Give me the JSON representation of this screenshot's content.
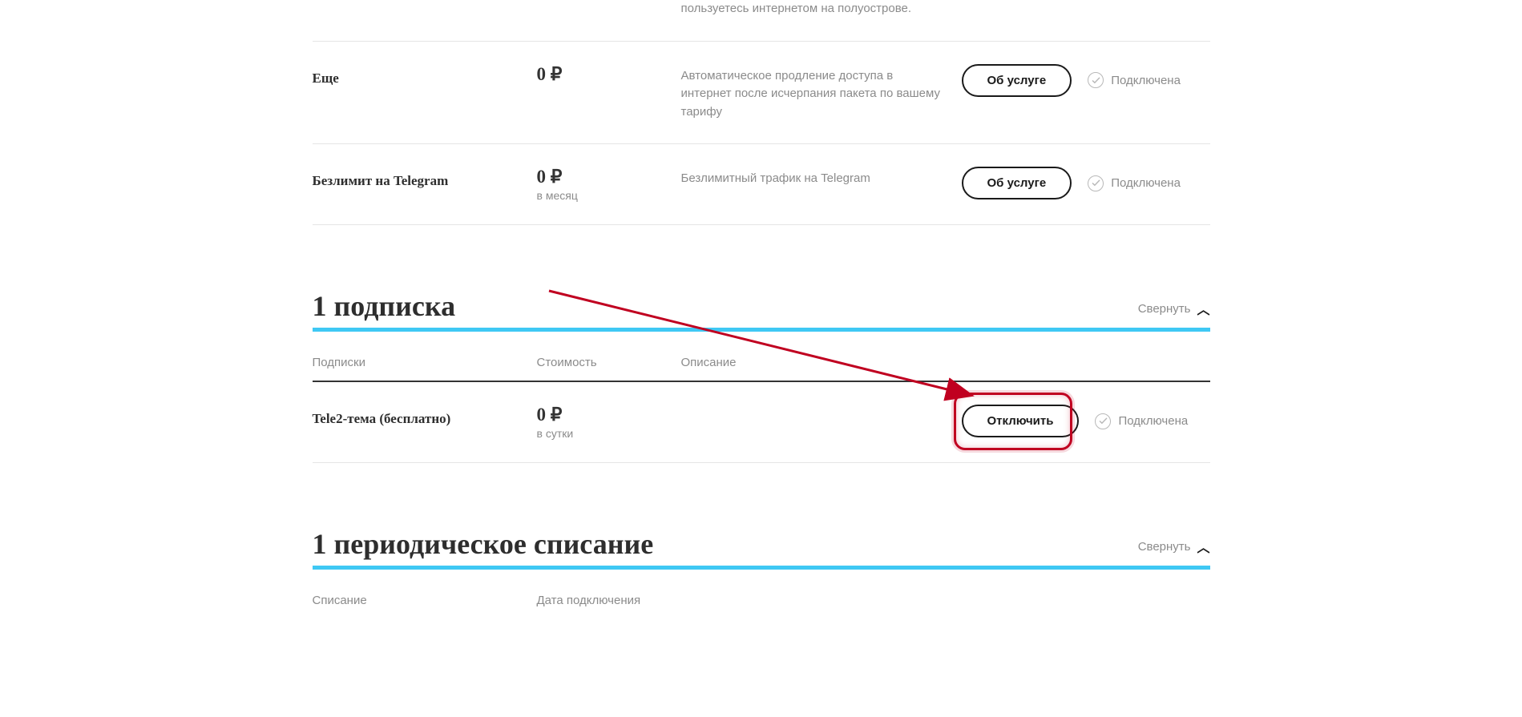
{
  "top_partial_desc": "пользуетесь интернетом на полуострове.",
  "services": [
    {
      "name": "Еще",
      "price": "0 ₽",
      "price_sub": "",
      "desc": "Автоматическое продление доступа в интернет после исчерпания пакета по вашему тарифу",
      "action": "Об услуге",
      "status": "Подключена"
    },
    {
      "name": "Безлимит на Telegram",
      "price": "0 ₽",
      "price_sub": "в месяц",
      "desc": "Безлимитный трафик на Telegram",
      "action": "Об услуге",
      "status": "Подключена"
    }
  ],
  "subscriptions_section": {
    "title": "1 подписка",
    "collapse": "Свернуть",
    "headers": {
      "name": "Подписки",
      "cost": "Стоимость",
      "desc": "Описание"
    },
    "rows": [
      {
        "name": "Tele2-тема (бесплатно)",
        "price": "0 ₽",
        "price_sub": "в сутки",
        "action": "Отключить",
        "status": "Подключена"
      }
    ]
  },
  "periodic_section": {
    "title": "1 периодическое списание",
    "collapse": "Свернуть",
    "headers": {
      "name": "Списание",
      "date": "Дата подключения"
    }
  }
}
